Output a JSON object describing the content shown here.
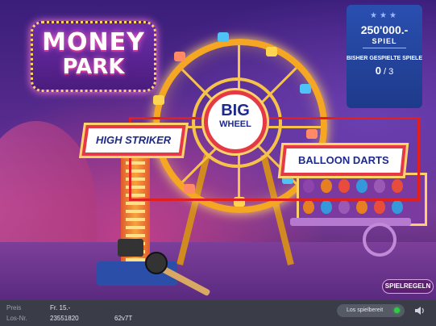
{
  "logo": {
    "line1": "MONEY",
    "line2": "PARK"
  },
  "jackpot": {
    "stars": "★★★",
    "amount": "250'000.-",
    "unit": "SPIEL",
    "played_label": "BISHER GESPIELTE SPIELE",
    "played_count": "0",
    "played_total": "/ 3"
  },
  "games": {
    "big_wheel_line1": "BIG",
    "big_wheel_line2": "WHEEL",
    "high_striker": "HIGH STRIKER",
    "balloon_darts": "BALLOON DARTS"
  },
  "rules_button": "SPIELREGELN",
  "footer": {
    "price_label": "Preis",
    "price_value": "Fr. 15.-",
    "ticket_label": "Los-Nr.",
    "ticket_value": "23551820",
    "ticket_code": "62v7T",
    "status_text": "Los spielbereit",
    "status_color": "#2ecc40",
    "sound_icon": "speaker-icon"
  },
  "colors": {
    "highlight": "#e02020",
    "sign_text": "#1d2a8c",
    "jackpot_bg": "#2a4fb0",
    "rules_bg": "#5b2170"
  }
}
